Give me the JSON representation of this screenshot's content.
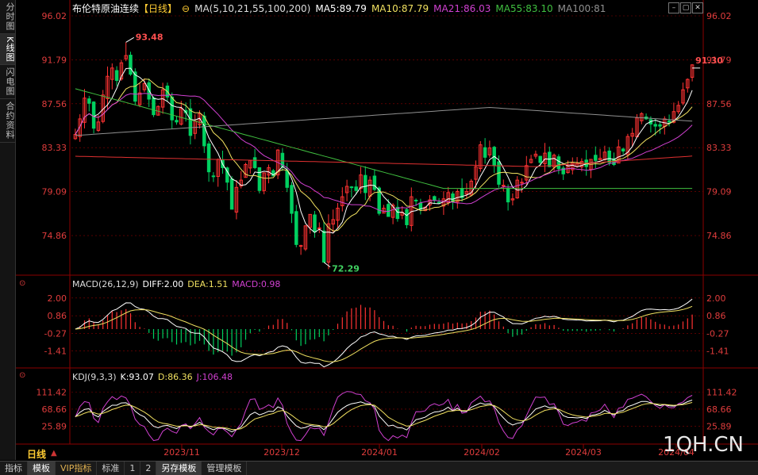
{
  "left_tabs": [
    "分时图",
    "K线图",
    "闪电图",
    "合约资料"
  ],
  "active_left_tab": 1,
  "title": {
    "name": "布伦特原油连续",
    "period": "【日线】",
    "ma_params": "MA(5,10,21,55,100,200)",
    "ma5": "MA5:89.79",
    "ma10": "MA10:87.79",
    "ma21": "MA21:86.03",
    "ma55": "MA55:83.10",
    "ma100": "MA100:81"
  },
  "colors": {
    "up": "#ff3232",
    "down": "#00d060",
    "ma5": "#ffffff",
    "ma10": "#f0e060",
    "ma21": "#d040d0",
    "ma55": "#40c040",
    "ma100": "#909090",
    "ma200": "#e03030",
    "grid": "#8b0000",
    "axis_text": "#e03c3c"
  },
  "price_axis": [
    "96.02",
    "91.79",
    "87.56",
    "83.33",
    "79.09",
    "74.86"
  ],
  "annotations": {
    "high": "93.48",
    "low": "72.29",
    "last": "91.30"
  },
  "macd": {
    "label": "MACD(26,12,9)",
    "diff": "DIFF:2.00",
    "dea": "DEA:1.51",
    "macd": "MACD:0.98",
    "axis": [
      "2.00",
      "0.86",
      "-0.27",
      "-1.41"
    ]
  },
  "kdj": {
    "label": "KDJ(9,3,3)",
    "k": "K:93.07",
    "d": "D:86.36",
    "j": "J:106.48",
    "axis": [
      "111.42",
      "68.66",
      "25.89"
    ]
  },
  "date_axis": [
    "2023/11",
    "2023/12",
    "2024/01",
    "2024/02",
    "2024/03",
    "2024/04"
  ],
  "period_button": "日线",
  "bottom_tabs": [
    "指标",
    "模板",
    "VIP指标",
    "标准",
    "1",
    "2",
    "另存模板",
    "管理模板"
  ],
  "watermark": "1QH.CN",
  "chart_data": {
    "type": "candlestick",
    "closes": [
      84.6,
      86.1,
      88.1,
      87.6,
      85.2,
      85.8,
      88.4,
      90.2,
      91.0,
      89.8,
      91.5,
      92.2,
      90.4,
      87.8,
      88.6,
      89.5,
      88.0,
      86.5,
      87.3,
      88.9,
      88.2,
      86.0,
      85.8,
      87.1,
      86.7,
      84.5,
      85.9,
      86.6,
      83.5,
      81.0,
      80.6,
      82.2,
      81.4,
      80.0,
      77.4,
      79.5,
      80.2,
      81.7,
      82.1,
      81.4,
      79.2,
      80.9,
      81.4,
      80.6,
      83.1,
      81.5,
      79.5,
      77.0,
      74.0,
      73.9,
      75.8,
      76.9,
      75.2,
      75.6,
      72.3,
      76.0,
      76.4,
      77.5,
      78.6,
      79.6,
      79.5,
      79.2,
      80.7,
      79.0,
      80.2,
      79.3,
      77.0,
      77.5,
      76.7,
      77.8,
      76.5,
      77.1,
      75.9,
      78.6,
      78.2,
      77.4,
      77.6,
      78.3,
      78.3,
      78.0,
      78.4,
      79.0,
      78.1,
      79.1,
      78.5,
      79.1,
      80.1,
      81.5,
      83.6,
      82.4,
      83.3,
      81.6,
      79.8,
      79.7,
      78.1,
      78.4,
      80.2,
      80.0,
      81.6,
      82.2,
      82.7,
      81.9,
      82.8,
      81.5,
      82.6,
      81.3,
      80.8,
      81.6,
      81.9,
      81.8,
      82.0,
      81.5,
      82.2,
      82.1,
      82.3,
      82.9,
      81.9,
      81.7,
      83.4,
      83.0,
      84.4,
      84.7,
      86.2,
      86.6,
      86.1,
      85.6,
      85.4,
      85.4,
      86.1,
      85.8,
      86.8,
      87.4,
      88.9,
      89.9,
      91.3
    ],
    "ylim": [
      71.2,
      96.02
    ],
    "high": 93.48,
    "low": 72.29,
    "last": 91.3,
    "x_ticks": [
      "2023/11",
      "2023/12",
      "2024/01",
      "2024/02",
      "2024/03",
      "2024/04"
    ]
  }
}
